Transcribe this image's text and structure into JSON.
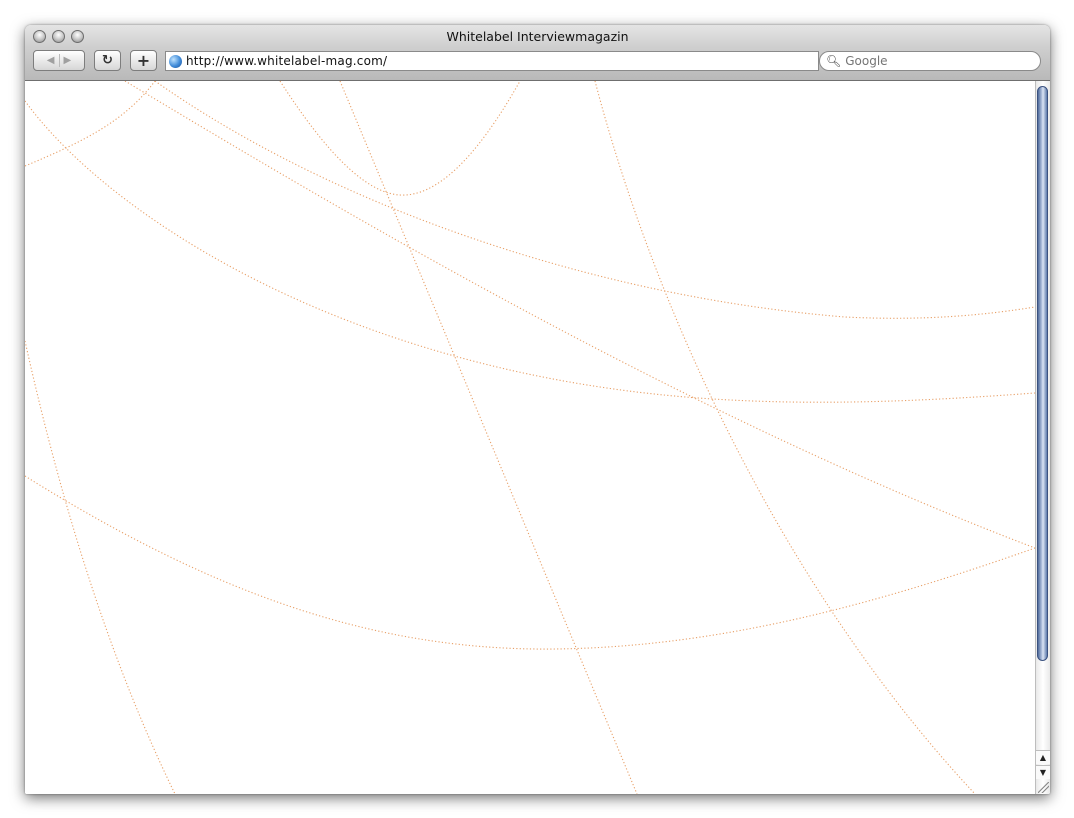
{
  "window": {
    "title": "Whitelabel Interviewmagazin"
  },
  "toolbar": {
    "back_glyph": "◀",
    "forward_glyph": "▶",
    "reload_glyph": "↻",
    "add_glyph": "+",
    "url": "http://www.whitelabel-mag.com/",
    "search_placeholder": "Google"
  },
  "icons": {
    "traffic_lights": [
      "close-icon",
      "minimize-icon",
      "zoom-icon"
    ],
    "page_icon": "globe-icon",
    "search": "magnifier-icon"
  },
  "content": {
    "decoration": "dotted orange curves",
    "line_color": "#e8a068"
  },
  "scrollbar": {
    "thumb_color": "#6a86b8"
  }
}
